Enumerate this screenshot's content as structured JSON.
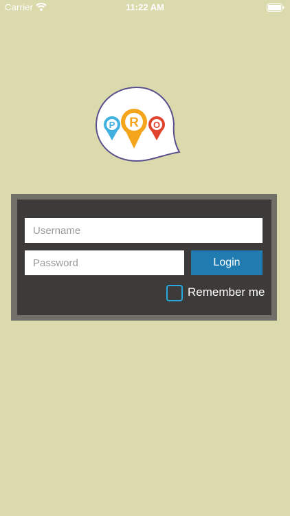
{
  "status_bar": {
    "carrier": "Carrier",
    "time": "11:22 AM"
  },
  "logo": {
    "letters": [
      "P",
      "R",
      "O"
    ],
    "colors": {
      "p": "#3fb0df",
      "r": "#f4a51c",
      "o": "#e0432e",
      "outline": "#5b4f8c"
    }
  },
  "form": {
    "username_placeholder": "Username",
    "password_placeholder": "Password",
    "login_label": "Login",
    "remember_label": "Remember me"
  },
  "colors": {
    "background": "#dbdaad",
    "panel": "#3d3b39",
    "panel_border": "#707068",
    "accent": "#1f7bb0",
    "checkbox": "#29a9e0"
  }
}
